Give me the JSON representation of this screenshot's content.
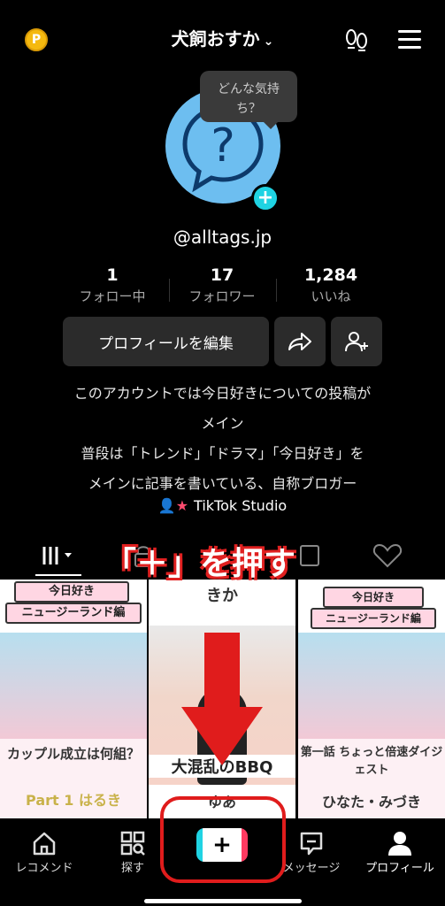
{
  "header": {
    "title": "犬飼おすか",
    "chevron": "⌄",
    "coin_icon": "coin-icon"
  },
  "profile": {
    "mood_bubble": "どんな気持ち？",
    "handle": "@alltags.jp",
    "stats": [
      {
        "value": "1",
        "label": "フォロー中"
      },
      {
        "value": "17",
        "label": "フォロワー"
      },
      {
        "value": "1,284",
        "label": "いいね"
      }
    ],
    "edit_button": "プロフィールを編集",
    "bio": [
      "このアカウントでは今日好きについての投稿が",
      "メイン",
      "普段は「トレンド」「ドラマ」「今日好き」を",
      "メインに記事を書いている、自称ブロガー"
    ],
    "studio_link": "TikTok Studio"
  },
  "grid": [
    {
      "top_label": "今日好き",
      "sub_label": "ニュージーランド編",
      "bottom_label": "カップル成立は何組？",
      "bottom_sub": "Part 1 はるき"
    },
    {
      "top_label": "きか",
      "bottom_label": "大混乱のBBQ",
      "bottom_sub": "ゆあ"
    },
    {
      "top_label": "今日好き",
      "sub_label": "ニュージーランド編",
      "bottom_label": "第一話 ちょっと倍速ダイジェスト",
      "bottom_sub": "ひなた・みづき"
    }
  ],
  "annotation": {
    "text": "「＋」を押す",
    "color": "#e01c1c"
  },
  "nav": [
    {
      "label": "レコメンド",
      "icon": "home-icon"
    },
    {
      "label": "探す",
      "icon": "search-grid-icon"
    },
    {
      "label": "+",
      "icon": "create-icon"
    },
    {
      "label": "メッセージ",
      "icon": "message-icon"
    },
    {
      "label": "プロフィール",
      "icon": "profile-icon"
    }
  ],
  "colors": {
    "accent_cyan": "#1fd3e3",
    "accent_red": "#ff3a61",
    "background": "#000000"
  }
}
